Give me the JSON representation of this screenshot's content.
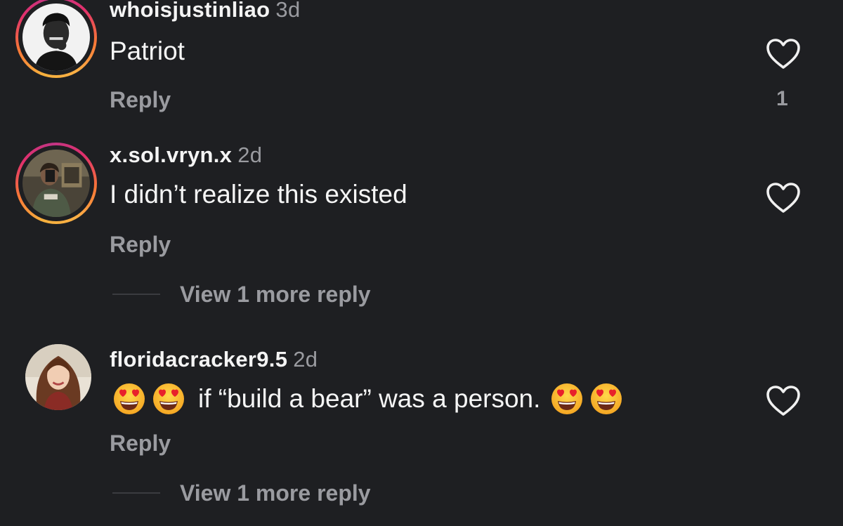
{
  "comments": [
    {
      "username": "whoisjustinliao",
      "time": "3d",
      "text": "Patriot",
      "reply_label": "Reply",
      "like_count": "1",
      "has_story_ring": true,
      "avatar_icon": "avatar-man-dark-bg"
    },
    {
      "username": "x.sol.vryn.x",
      "time": "2d",
      "text": "I didn’t realize this existed",
      "reply_label": "Reply",
      "like_count": "",
      "has_story_ring": true,
      "avatar_icon": "avatar-mirror-selfie",
      "view_more": "View 1 more reply"
    },
    {
      "username": "floridacracker9.5",
      "time": "2d",
      "text": "if “build a bear” was a person.",
      "reply_label": "Reply",
      "like_count": "",
      "has_story_ring": false,
      "avatar_icon": "avatar-woman-curly-hair",
      "leading_emoji": [
        "heart-eyes-emoji",
        "heart-eyes-emoji"
      ],
      "trailing_emoji": [
        "heart-eyes-emoji",
        "heart-eyes-emoji"
      ],
      "view_more": "View 1 more reply"
    }
  ],
  "colors": {
    "background": "#1e1f22",
    "primary_text": "#f5f5f5",
    "secondary_text": "#9a9ba0"
  }
}
